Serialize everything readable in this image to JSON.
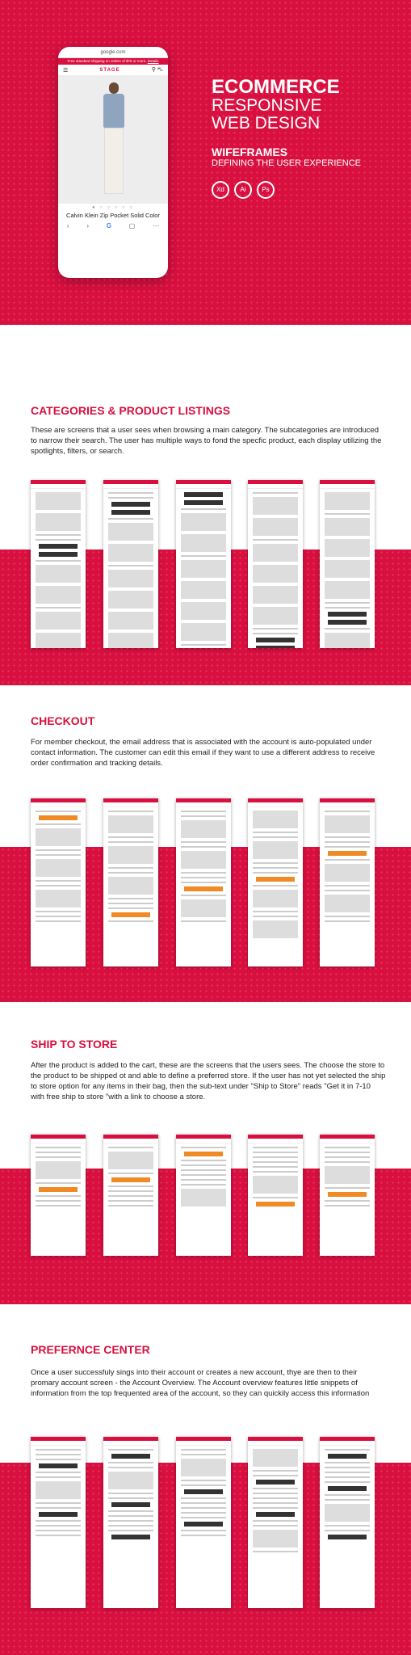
{
  "hero": {
    "url": "google.com",
    "promo": "Free standard shipping on orders of $75 or more.",
    "promo_link": "Details",
    "logo": "STAGE",
    "product_title": "Calvin Klein Zip Pocket Solid Color",
    "title_line1": "ECOMMERCE",
    "title_line2": "RESPONSIVE",
    "title_line3": "WEB DESIGN",
    "wireframes": "WIFEFRAMES",
    "wireframes_sub": "DEFINING THE USER EXPERIENCE",
    "tools": [
      "Xd",
      "Ai",
      "Ps"
    ]
  },
  "sections": [
    {
      "title": "CATEGORIES & PRODUCT LISTINGS",
      "text": "These are screens that a user sees when browsing a main category. The subcategories are introduced to narrow their search. The user has multiple ways to fond the specfic product, each display utilizing the spotlights, filters, or search."
    },
    {
      "title": "CHECKOUT",
      "text": "For member checkout, the email address that is associated with the account is auto-populated under contact information. The customer can edit this email if they want to use a different address to receive order confirmation and tracking details."
    },
    {
      "title": "SHIP TO STORE",
      "text": "After the product is added to the cart, these are the screens that the users sees. The choose the store to the product to be shipped ot and able to define a preferred store. If the user has not yet selected the ship to store option for any items in their bag, then the sub-text under \"Ship to Store\" reads \"Get it in 7-10 with free ship to store \"with a link to choose a store."
    },
    {
      "title": "PREFERNCE CENTER",
      "text": "Once a user successfuly sings into their account or creates a new account, thye are then to their promary account screen - the Account Overview. The Account overview features little snippets of information  from the top frequented area of the account, so they can quickily access this information"
    }
  ],
  "colors": {
    "brand": "#d80f3f",
    "accent": "#f08a24"
  }
}
